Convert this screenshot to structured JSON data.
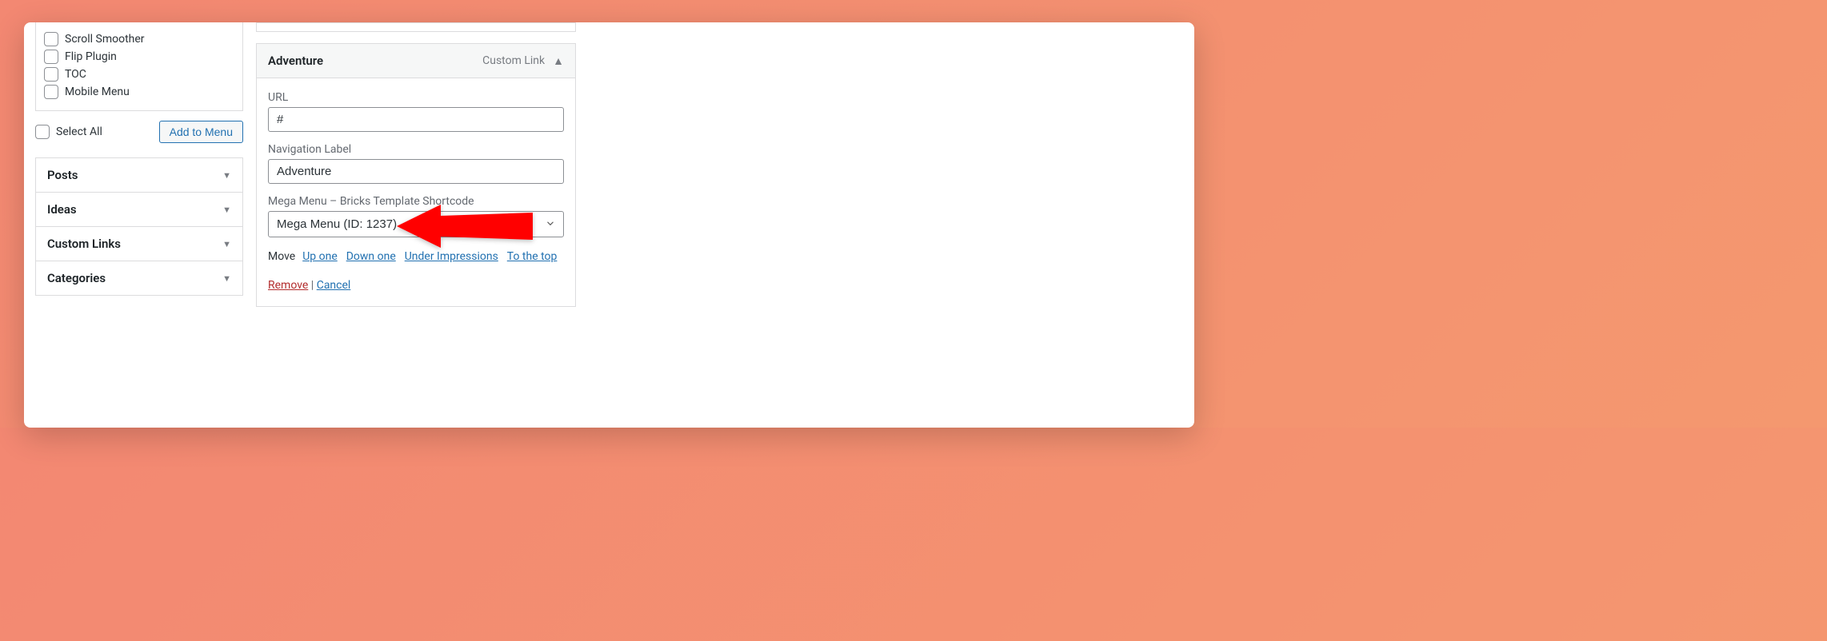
{
  "sidebar": {
    "checkboxItems": [
      {
        "label": "Scroll Smoother"
      },
      {
        "label": "Flip Plugin"
      },
      {
        "label": "TOC"
      },
      {
        "label": "Mobile Menu"
      }
    ],
    "selectAll": "Select All",
    "addToMenu": "Add to Menu",
    "accordion": [
      {
        "label": "Posts"
      },
      {
        "label": "Ideas"
      },
      {
        "label": "Custom Links"
      },
      {
        "label": "Categories"
      }
    ]
  },
  "panel": {
    "title": "Adventure",
    "type": "Custom Link",
    "urlLabel": "URL",
    "urlValue": "#",
    "navLabel": "Navigation Label",
    "navValue": "Adventure",
    "megaLabel": "Mega Menu – Bricks Template Shortcode",
    "megaValue": "Mega Menu (ID: 1237)",
    "moveLabel": "Move",
    "moveUp": "Up one",
    "moveDown": "Down one",
    "moveUnder": "Under Impressions",
    "moveTop": "To the top",
    "remove": "Remove",
    "sep": " | ",
    "cancel": "Cancel"
  }
}
